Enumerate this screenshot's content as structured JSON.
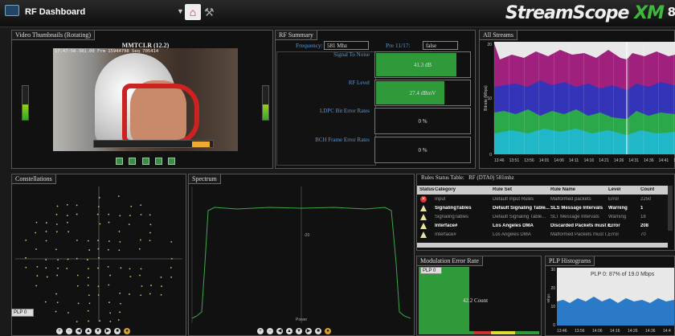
{
  "header": {
    "dashboard_select": "RF Dashboard",
    "logo_main": "StreamScope",
    "logo_xm": "XM",
    "logo_extra": "8"
  },
  "video": {
    "title": "Video Thumbnails (Rotating)",
    "program": "MMTCLR (12.2)",
    "timestamp": "17:47:58.381.00 Frm 15944798 Seq 705414",
    "level_left": 0.45,
    "level_right": 0.45
  },
  "rf_summary": {
    "title": "RF Summary",
    "frequency_label": "Frequency:",
    "frequency_value": "581 Mhz",
    "pre_label": "Pre 11/17:",
    "pre_value": "false",
    "meters": [
      {
        "label": "Signal To Noise",
        "value": "41.3 dB",
        "fill": 0.85
      },
      {
        "label": "RF Level",
        "value": "27.4 dBmV",
        "fill": 0.72
      },
      {
        "label": "LDPC Bit Error Rates",
        "value": "0 %",
        "fill": 0
      },
      {
        "label": "BCH Frame Error Rates",
        "value": "0 %",
        "fill": 0
      }
    ]
  },
  "all_streams": {
    "title": "All Streams",
    "ylabel": "Bitrate (Mbps)",
    "ymax_label": "20",
    "ymid_label": "10",
    "ymin_label": "0",
    "x_ticks": [
      "13:46",
      "13:51",
      "13:56",
      "14:01",
      "14:06",
      "14:11",
      "14:16",
      "14:21",
      "14:26",
      "14:31",
      "14:36",
      "14:41",
      "14:4"
    ]
  },
  "constellations": {
    "title": "Constellations",
    "plp_select": "PLP 0"
  },
  "spectrum": {
    "title": "Spectrum",
    "mid_label": "-20",
    "bottom_label": "Power"
  },
  "rules": {
    "title": "Rules Status Table:",
    "subtitle": "RF (DTA0) 581mhz",
    "columns": [
      "Status",
      "Category",
      "Rule Set",
      "Rule Name",
      "Level",
      "Count"
    ],
    "rows": [
      {
        "status": "error",
        "category": "Input",
        "ruleset": "Default Input Rules",
        "rule": "Malformed packets",
        "level": "Error",
        "count": "2250",
        "style": "dim"
      },
      {
        "status": "warn",
        "category": "SignalingTables",
        "ruleset": "Default Signaling Table...",
        "rule": "SLS Message Intervals",
        "level": "Warning",
        "count": "1",
        "style": "hi"
      },
      {
        "status": "warn",
        "category": "SignalingTables",
        "ruleset": "Default Signaling Table...",
        "rule": "SLT Message Intervals",
        "level": "Warning",
        "count": "18",
        "style": "dim"
      },
      {
        "status": "warn",
        "category": "Interface#",
        "ruleset": "Los Angeles DMA",
        "rule": "Discarded Packets must r...",
        "level": "Error",
        "count": "208",
        "style": "hi"
      },
      {
        "status": "warn",
        "category": "Interface#",
        "ruleset": "Los Angeles DMA",
        "rule": "Malformed Packets must r...",
        "level": "Error",
        "count": "70",
        "style": "dim"
      }
    ]
  },
  "mer": {
    "title": "Modulation Error Rate",
    "plp_select": "PLP 0",
    "value": "42.2 Count"
  },
  "plp_hist": {
    "title": "PLP Histograms",
    "summary": "PLP 0: 87% of 19.0 Mbps",
    "ylabel": "Mbps",
    "y_labels": [
      "30",
      "20",
      "10",
      "0"
    ],
    "x_ticks": [
      "13:46",
      "13:56",
      "14:06",
      "14:16",
      "14:26",
      "14:36",
      "14:4"
    ]
  },
  "colors": {
    "accent_green": "#2e9a3a",
    "label_blue": "#5599dd",
    "stream_magenta": "#a0207e",
    "stream_blue": "#3434b8",
    "stream_green": "#2aa84a",
    "stream_cyan": "#20b8c8"
  }
}
